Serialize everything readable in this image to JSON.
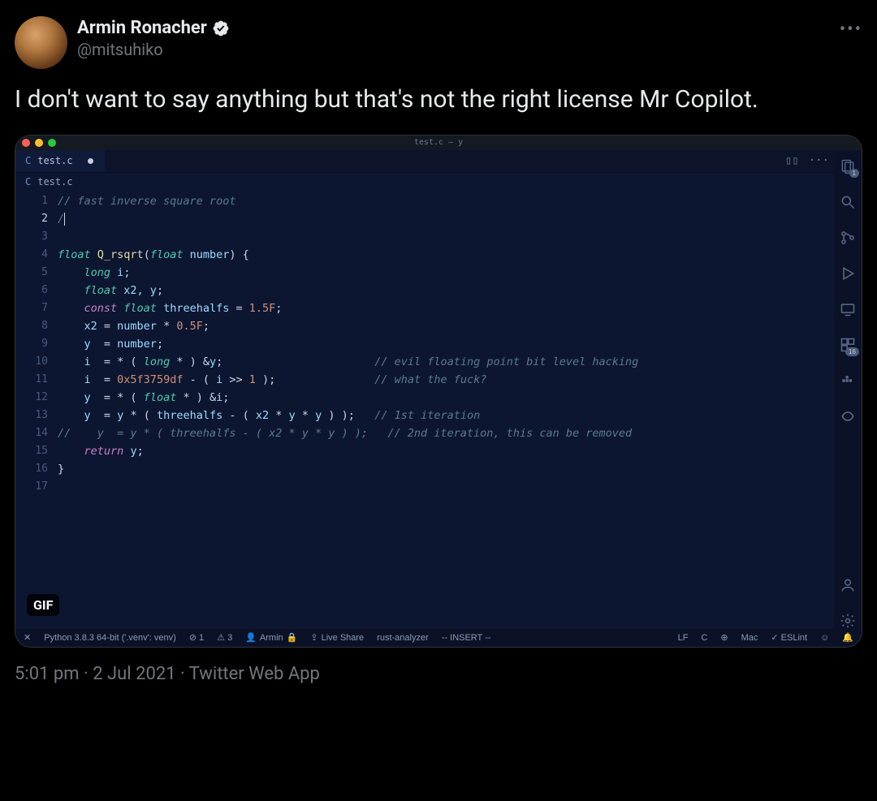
{
  "tweet": {
    "author_name": "Armin Ronacher",
    "author_handle": "@mitsuhiko",
    "text": "I don't want to say anything but that's not the right license Mr Copilot.",
    "time": "5:01 pm",
    "date": "2 Jul 2021",
    "source": "Twitter Web App",
    "gif_badge": "GIF",
    "more": "•••"
  },
  "vscode": {
    "window_title": "test.c — y",
    "tab": {
      "icon_label": "C",
      "filename": "test.c"
    },
    "tabbar_actions": {
      "split": "▯▯",
      "more": "···"
    },
    "breadcrumb": {
      "icon_label": "C",
      "filename": "test.c"
    },
    "activity_badges": {
      "explorer": "1",
      "extensions": "16"
    },
    "lines": [
      "1",
      "2",
      "3",
      "4",
      "5",
      "6",
      "7",
      "8",
      "9",
      "10",
      "11",
      "12",
      "13",
      "14",
      "15",
      "16",
      "17"
    ],
    "code": {
      "l1": "// fast inverse square root",
      "l2": "/",
      "l4_kw": "float",
      "l4_fn": "Q_rsqrt",
      "l4_param_t": "float",
      "l4_param": "number",
      "l5_t": "long",
      "l5_v": "i",
      "l6_t": "float",
      "l6_v": "x2, y",
      "l7_kw": "const",
      "l7_t": "float",
      "l7_v": "threehalfs",
      "l7_n": "1.5F",
      "l8_a": "x2",
      "l8_b": "number",
      "l8_n": "0.5F",
      "l9_a": "y",
      "l9_b": "number",
      "l10_a": "i",
      "l10_t": "long",
      "l10_b": "y",
      "l10_c": "// evil floating point bit level hacking",
      "l11_a": "i",
      "l11_n": "0x5f3759df",
      "l11_b": "i",
      "l11_s": "1",
      "l11_c": "// what the fuck?",
      "l12_a": "y",
      "l12_t": "float",
      "l12_b": "i",
      "l13_a": "y",
      "l13_b": "y",
      "l13_v": "threehalfs",
      "l13_x": "x2",
      "l13_c": "// 1st iteration",
      "l14": "//    y  = y * ( threehalfs - ( x2 * y * y ) );   // 2nd iteration, this can be removed",
      "l15_kw": "return",
      "l15_v": "y"
    },
    "statusbar": {
      "remote": "✕",
      "python": "Python 3.8.3 64-bit ('.venv': venv)",
      "problems_err": "⊘ 1",
      "problems_warn": "⚠ 3",
      "user": "Armin",
      "liveshare": "Live Share",
      "rust": "rust-analyzer",
      "vim": "-- INSERT --",
      "eol": "LF",
      "lang": "C",
      "copilot": "⊕",
      "os": "Mac",
      "eslint": "✓ ESLint"
    }
  }
}
